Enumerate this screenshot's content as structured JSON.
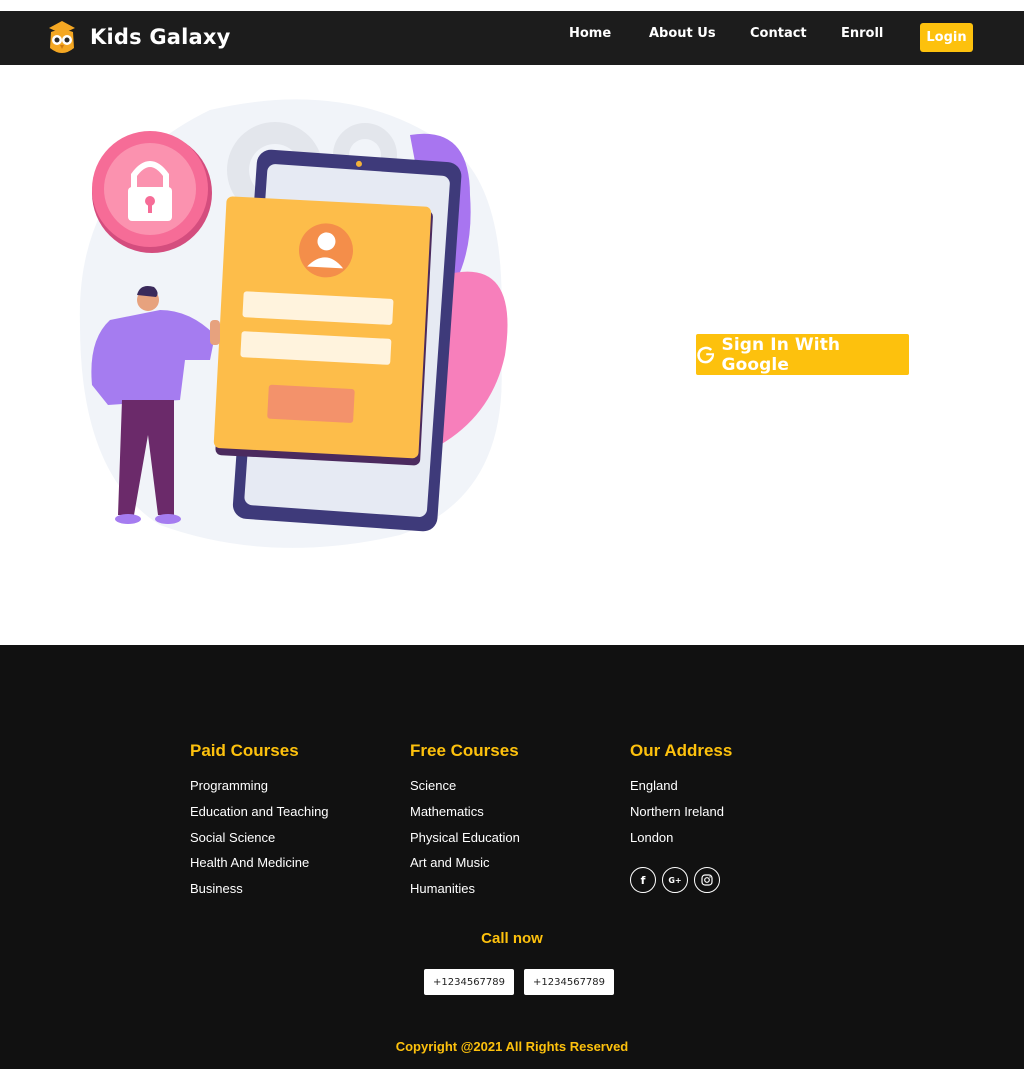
{
  "nav": {
    "brand": "Kids Galaxy",
    "links": [
      "Home",
      "About Us",
      "Contact",
      "Enroll"
    ],
    "login": "Login"
  },
  "hero": {
    "google_button": "Sign In With Google"
  },
  "footer": {
    "paid": {
      "title": "Paid Courses",
      "items": [
        "Programming",
        "Education and Teaching",
        "Social Science",
        "Health And Medicine",
        "Business"
      ]
    },
    "free": {
      "title": "Free Courses",
      "items": [
        "Science",
        "Mathematics",
        "Physical Education",
        "Art and Music",
        "Humanities"
      ]
    },
    "address": {
      "title": "Our Address",
      "items": [
        "England",
        "Northern Ireland",
        "London"
      ]
    },
    "social": [
      "facebook-icon",
      "google-plus-icon",
      "instagram-icon"
    ],
    "call_now": "Call now",
    "phones": [
      "+1234567789",
      "+1234567789"
    ],
    "copyright": "Copyright @2021 All Rights Reserved"
  },
  "colors": {
    "accent": "#fdc10d",
    "navbar": "#1c1c1c",
    "footer": "#111111"
  }
}
